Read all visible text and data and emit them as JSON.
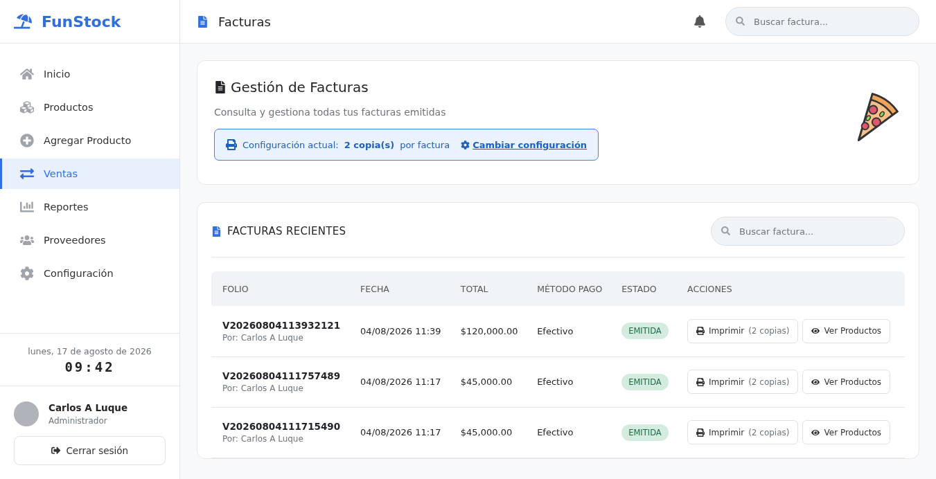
{
  "brand": "FunStock",
  "sidebar": {
    "items": [
      {
        "label": "Inicio",
        "selected": false
      },
      {
        "label": "Productos",
        "selected": false
      },
      {
        "label": "Agregar Producto",
        "selected": false
      },
      {
        "label": "Ventas",
        "selected": true
      },
      {
        "label": "Reportes",
        "selected": false
      },
      {
        "label": "Proveedores",
        "selected": false
      },
      {
        "label": "Configuración",
        "selected": false
      }
    ],
    "date": "lunes, 17 de agosto de 2026",
    "time": "09:42",
    "user": {
      "name": "Carlos A Luque",
      "role": "Administrador"
    },
    "logout": "Cerrar sesión"
  },
  "header": {
    "title": "Facturas",
    "search_placeholder": "Buscar factura..."
  },
  "hero": {
    "title": "Gestión de Facturas",
    "subtitle": "Consulta y gestiona todas tus facturas emitidas",
    "config_label": "Configuración actual:",
    "config_value": "2 copia(s)",
    "config_suffix": "por factura",
    "config_link": "Cambiar configuración"
  },
  "invoices": {
    "title": "FACTURAS RECIENTES",
    "search_placeholder": "Buscar factura...",
    "columns": [
      "FOLIO",
      "FECHA",
      "TOTAL",
      "MÉTODO PAGO",
      "ESTADO",
      "ACCIONES"
    ],
    "rows": [
      {
        "folio": "V20260804113932121",
        "by": "Por: Carlos A Luque",
        "date": "04/08/2026 11:39",
        "total": "$120,000.00",
        "method": "Efectivo",
        "status": "EMITIDA",
        "print": "Imprimir",
        "copies": "(2 copias)",
        "view": "Ver Productos"
      },
      {
        "folio": "V20260804111757489",
        "by": "Por: Carlos A Luque",
        "date": "04/08/2026 11:17",
        "total": "$45,000.00",
        "method": "Efectivo",
        "status": "EMITIDA",
        "print": "Imprimir",
        "copies": "(2 copias)",
        "view": "Ver Productos"
      },
      {
        "folio": "V20260804111715490",
        "by": "Por: Carlos A Luque",
        "date": "04/08/2026 11:17",
        "total": "$45,000.00",
        "method": "Efectivo",
        "status": "EMITIDA",
        "print": "Imprimir",
        "copies": "(2 copias)",
        "view": "Ver Productos"
      }
    ]
  }
}
